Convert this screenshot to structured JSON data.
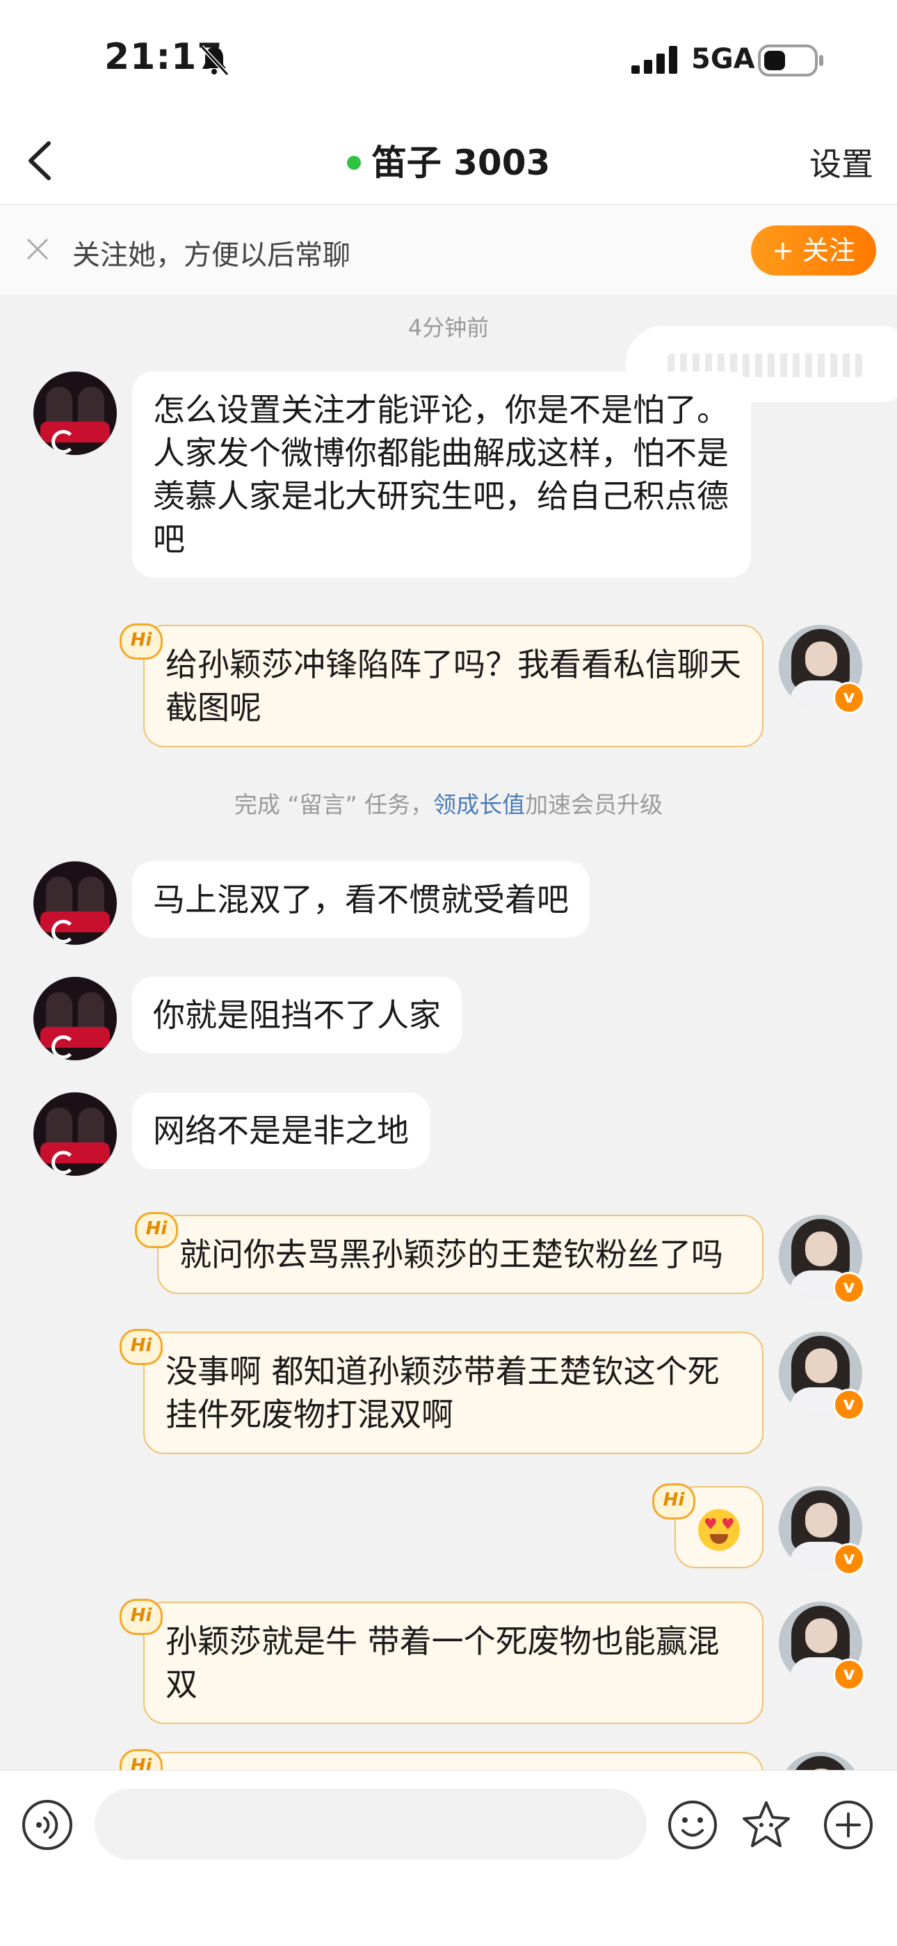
{
  "status_bar": {
    "time": "21:17",
    "network": "5GA"
  },
  "nav": {
    "title": "笛子 3003",
    "settings": "设置"
  },
  "follow_banner": {
    "text": "关注她，方便以后常聊",
    "button": "+ 关注"
  },
  "chat": {
    "timestamp": "4分钟前",
    "messages": [
      {
        "side": "in",
        "text": "怎么设置关注才能评论，你是不是怕了。人家发个微博你都能曲解成这样，怕不是羡慕人家是北大研究生吧，给自己积点德吧"
      },
      {
        "side": "out",
        "text": "给孙颖莎冲锋陷阵了吗？我看看私信聊天截图呢"
      },
      {
        "side": "in",
        "text": "马上混双了，看不惯就受着吧"
      },
      {
        "side": "in",
        "text": "你就是阻挡不了人家"
      },
      {
        "side": "in",
        "text": "网络不是是非之地"
      },
      {
        "side": "out",
        "text": "就问你去骂黑孙颖莎的王楚钦粉丝了吗"
      },
      {
        "side": "out",
        "text": "没事啊 都知道孙颖莎带着王楚钦这个死挂件死废物打混双啊"
      },
      {
        "side": "out",
        "text": "",
        "emoji": "heart-eyes"
      },
      {
        "side": "out",
        "text": "孙颖莎就是牛 带着一个死废物也能赢混双"
      }
    ],
    "system_notice": {
      "prefix": "完成 “留言” 任务，",
      "link": "领成长值",
      "suffix": "加速会员升级"
    },
    "hi_label": "Hi",
    "vip_badge": "v"
  },
  "input": {
    "placeholder": ""
  },
  "colors": {
    "accent": "#ff8a00",
    "online": "#2fc440",
    "link": "#4a7bb7"
  }
}
